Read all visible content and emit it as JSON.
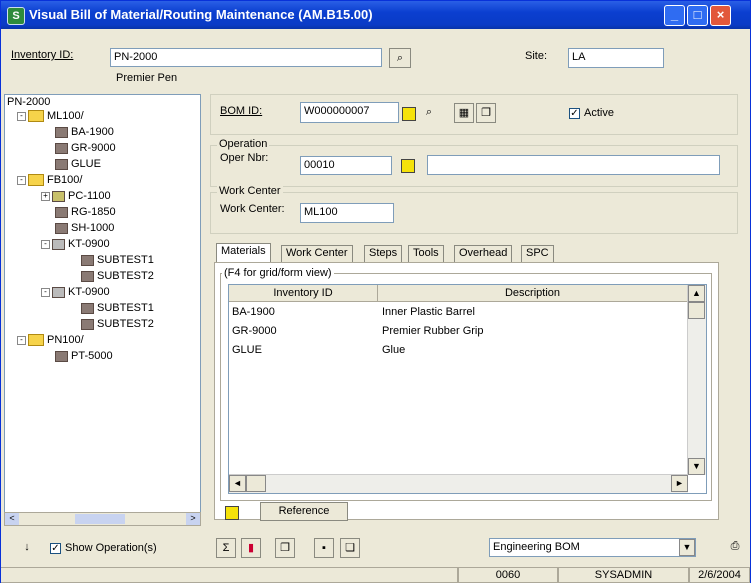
{
  "window": {
    "title": "Visual Bill of Material/Routing Maintenance (AM.B15.00)"
  },
  "header": {
    "inventory_label": "Inventory ID:",
    "inventory_value": "PN-2000",
    "inventory_desc": "Premier Pen",
    "site_label": "Site:",
    "site_value": "LA"
  },
  "tree": {
    "root": "PN-2000",
    "nodes": [
      "ML100/",
      "BA-1900",
      "GR-9000",
      "GLUE",
      "FB100/",
      "PC-1100",
      "RG-1850",
      "SH-1000",
      "KT-0900",
      "SUBTEST1",
      "SUBTEST2",
      "KT-0900",
      "SUBTEST1",
      "SUBTEST2",
      "PN100/",
      "PT-5000"
    ]
  },
  "bom": {
    "label": "BOM ID:",
    "value": "W000000007",
    "active_label": "Active"
  },
  "operation": {
    "legend": "Operation",
    "label": "Oper Nbr:",
    "value": "00010",
    "desc": ""
  },
  "workcenter": {
    "legend": "Work Center",
    "label": "Work Center:",
    "value": "ML100"
  },
  "tabs": [
    "Materials",
    "Work Center",
    "Steps",
    "Tools",
    "Overhead",
    "SPC"
  ],
  "grid": {
    "hint": "(F4 for grid/form view)",
    "columns": [
      "Inventory ID",
      "Description"
    ],
    "rows": [
      [
        "BA-1900",
        "Inner Plastic Barrel"
      ],
      [
        "GR-9000",
        "Premier Rubber Grip"
      ],
      [
        "GLUE",
        "Glue"
      ]
    ],
    "reference_label": "Reference"
  },
  "footer": {
    "show_ops_label": "Show Operation(s)",
    "bom_type": "Engineering BOM"
  },
  "status": {
    "code": "0060",
    "user": "SYSADMIN",
    "date": "2/6/2004"
  },
  "colors": {
    "accent": "#0b3fd0",
    "yellow_button": "#f5e20a"
  }
}
